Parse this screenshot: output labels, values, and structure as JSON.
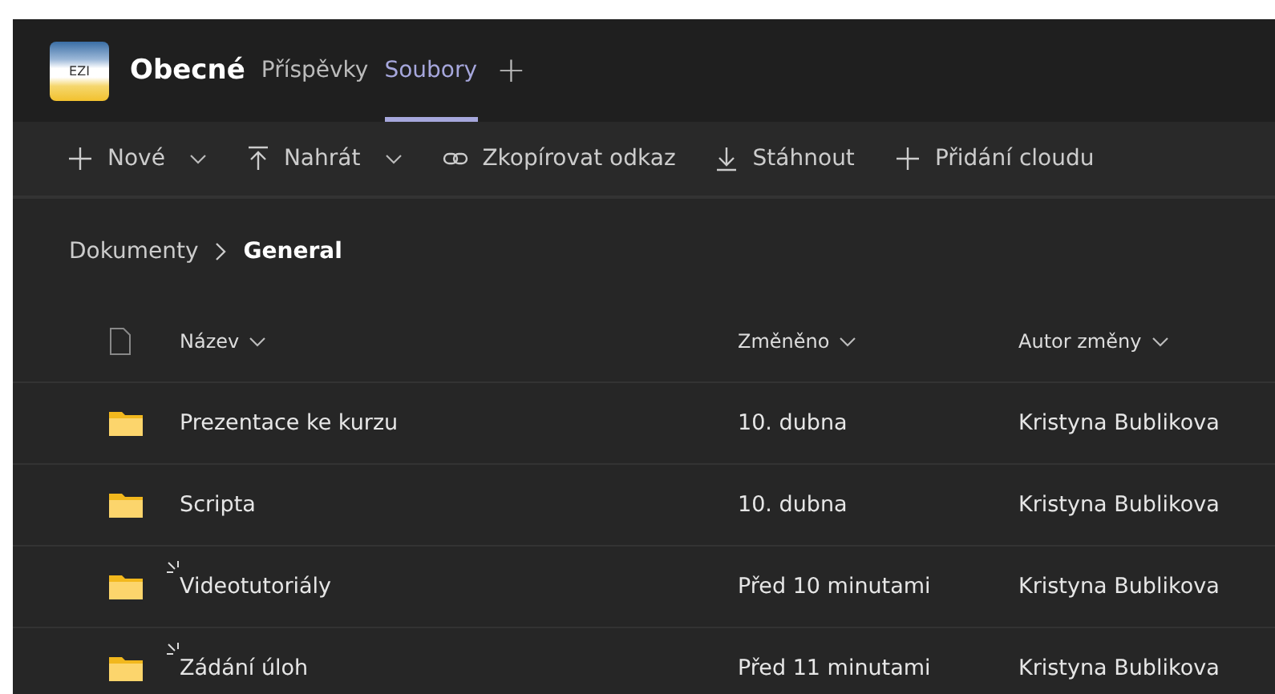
{
  "header": {
    "logo_text": "EZI",
    "channel": "Obecné",
    "tabs": [
      {
        "label": "Příspěvky",
        "selected": false
      },
      {
        "label": "Soubory",
        "selected": true
      }
    ],
    "add_tab": "+"
  },
  "toolbar": [
    {
      "kind": "plus",
      "label": "Nové",
      "dropdown": true
    },
    {
      "kind": "upload",
      "label": "Nahrát",
      "dropdown": true
    },
    {
      "kind": "link",
      "label": "Zkopírovat odkaz",
      "dropdown": false
    },
    {
      "kind": "download",
      "label": "Stáhnout",
      "dropdown": false
    },
    {
      "kind": "plus",
      "label": "Přidání cloudu",
      "dropdown": false
    }
  ],
  "breadcrumb": [
    {
      "label": "Dokumenty",
      "current": false
    },
    {
      "label": "General",
      "current": true
    }
  ],
  "table": {
    "columns": [
      "Název",
      "Změněno",
      "Autor změny"
    ],
    "rows": [
      {
        "name": "Prezentace ke kurzu",
        "modified": "10. dubna",
        "author": "Kristyna Bublikova",
        "new": false
      },
      {
        "name": "Scripta",
        "modified": "10. dubna",
        "author": "Kristyna Bublikova",
        "new": false
      },
      {
        "name": "Videotutoriály",
        "modified": "Před 10 minutami",
        "author": "Kristyna Bublikova",
        "new": true
      },
      {
        "name": "Zádání úloh",
        "modified": "Před 11 minutami",
        "author": "Kristyna Bublikova",
        "new": true
      }
    ]
  }
}
